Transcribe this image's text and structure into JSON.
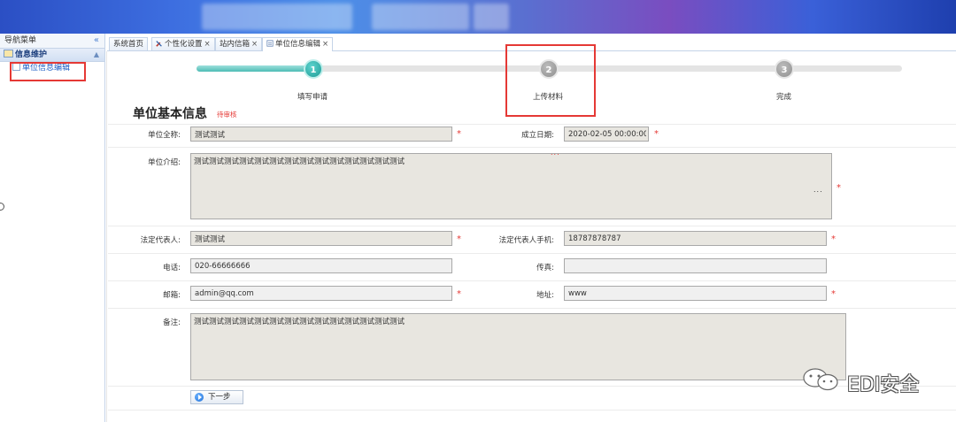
{
  "sidebar": {
    "header": "导航菜单",
    "collapse_glyph": "«",
    "group": "信息维护",
    "group_toggle": "▲",
    "items": [
      {
        "label": "单位信息编辑"
      }
    ]
  },
  "tabs": [
    {
      "label": "系统首页"
    },
    {
      "label": "个性化设置",
      "close": "×",
      "icon": "wrench-icon"
    },
    {
      "label": "站内信箱",
      "close": "×"
    },
    {
      "label": "单位信息编辑",
      "close": "×",
      "icon": "form-icon",
      "active": true
    }
  ],
  "steps": [
    {
      "number": "1",
      "label": "填写申请",
      "state": "active"
    },
    {
      "number": "2",
      "label": "上传材料",
      "state": "inactive"
    },
    {
      "number": "3",
      "label": "完成",
      "state": "inactive"
    }
  ],
  "progress": 0.16,
  "form": {
    "title": "单位基本信息",
    "status": "待审核",
    "fields": {
      "full_name": {
        "label": "单位全称:",
        "value": "测试测试",
        "required": true
      },
      "established": {
        "label": "成立日期:",
        "value": "2020-02-05 00:00:00",
        "required": true
      },
      "intro": {
        "label": "单位介绍:",
        "value": "测试测试测试测试测试测试测试测试测试测试测试测试测试测试",
        "required": true
      },
      "legal_rep": {
        "label": "法定代表人:",
        "value": "测试测试",
        "required": true
      },
      "legal_rep_phone": {
        "label": "法定代表人手机:",
        "value": "18787878787",
        "required": true
      },
      "phone": {
        "label": "电话:",
        "value": "020-66666666",
        "required": false
      },
      "fax": {
        "label": "传真:",
        "value": "",
        "required": false
      },
      "email": {
        "label": "邮箱:",
        "value": "admin@qq.com",
        "required": true
      },
      "address": {
        "label": "地址:",
        "value": "www",
        "required": true
      },
      "remark": {
        "label": "备注:",
        "value": "测试测试测试测试测试测试测试测试测试测试测试测试测试测试",
        "required": false
      }
    },
    "required_mark": "*",
    "ellipsis": "...",
    "next_button": "下一步"
  },
  "watermark": {
    "text": "EDI安全",
    "icon": "wechat-icon"
  },
  "colors": {
    "accent": "#2bb3ad",
    "required": "#e53935",
    "highlight_box": "#e53935"
  }
}
